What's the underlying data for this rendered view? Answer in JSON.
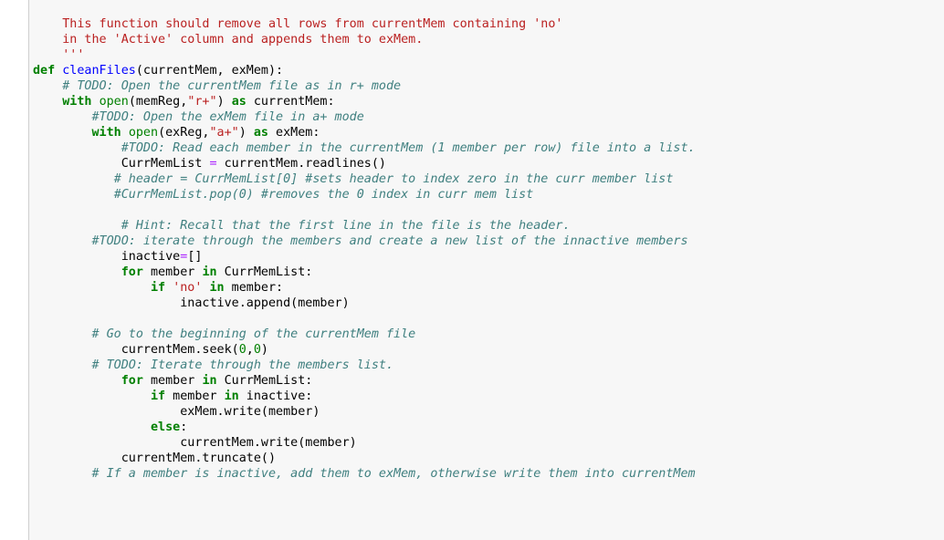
{
  "editor": {
    "lines": [
      [
        {
          "t": "    "
        },
        {
          "t": "This function should remove all rows from currentMem containing 'no'",
          "c": "doc"
        }
      ],
      [
        {
          "t": "    "
        },
        {
          "t": "in the 'Active' column and appends them to exMem.",
          "c": "doc"
        }
      ],
      [
        {
          "t": "    "
        },
        {
          "t": "'''",
          "c": "doc"
        }
      ],
      [
        {
          "t": "def",
          "c": "kw"
        },
        {
          "t": " "
        },
        {
          "t": "cleanFiles",
          "c": "fn"
        },
        {
          "t": "(currentMem, exMem):"
        }
      ],
      [
        {
          "t": "    "
        },
        {
          "t": "# TODO: Open the currentMem file as in r+ mode",
          "c": "cm"
        }
      ],
      [
        {
          "t": "    "
        },
        {
          "t": "with",
          "c": "kw"
        },
        {
          "t": " "
        },
        {
          "t": "open",
          "c": "nb"
        },
        {
          "t": "(memReg,"
        },
        {
          "t": "\"r+\"",
          "c": "st"
        },
        {
          "t": ") "
        },
        {
          "t": "as",
          "c": "kw"
        },
        {
          "t": " currentMem:"
        }
      ],
      [
        {
          "t": "        "
        },
        {
          "t": "#TODO: Open the exMem file in a+ mode",
          "c": "cm"
        }
      ],
      [
        {
          "t": "        "
        },
        {
          "t": "with",
          "c": "kw"
        },
        {
          "t": " "
        },
        {
          "t": "open",
          "c": "nb"
        },
        {
          "t": "(exReg,"
        },
        {
          "t": "\"a+\"",
          "c": "st"
        },
        {
          "t": ") "
        },
        {
          "t": "as",
          "c": "kw"
        },
        {
          "t": " exMem:"
        }
      ],
      [
        {
          "t": "            "
        },
        {
          "t": "#TODO: Read each member in the currentMem (1 member per row) file into a list.",
          "c": "cm"
        }
      ],
      [
        {
          "t": "            CurrMemList "
        },
        {
          "t": "=",
          "c": "op"
        },
        {
          "t": " currentMem.readlines()"
        }
      ],
      [
        {
          "t": "           "
        },
        {
          "t": "# header = CurrMemList[0] #sets header to index zero in the curr member list",
          "c": "cm"
        }
      ],
      [
        {
          "t": "           "
        },
        {
          "t": "#CurrMemList.pop(0) #removes the 0 index in curr mem list",
          "c": "cm"
        }
      ],
      [
        {
          "t": ""
        }
      ],
      [
        {
          "t": "            "
        },
        {
          "t": "# Hint: Recall that the first line in the file is the header.",
          "c": "cm"
        }
      ],
      [
        {
          "t": "        "
        },
        {
          "t": "#TODO: iterate through the members and create a new list of the innactive members",
          "c": "cm"
        }
      ],
      [
        {
          "t": "            inactive"
        },
        {
          "t": "=",
          "c": "op"
        },
        {
          "t": "[]"
        }
      ],
      [
        {
          "t": "            "
        },
        {
          "t": "for",
          "c": "kw"
        },
        {
          "t": " member "
        },
        {
          "t": "in",
          "c": "kw"
        },
        {
          "t": " CurrMemList:"
        }
      ],
      [
        {
          "t": "                "
        },
        {
          "t": "if",
          "c": "kw"
        },
        {
          "t": " "
        },
        {
          "t": "'no'",
          "c": "st"
        },
        {
          "t": " "
        },
        {
          "t": "in",
          "c": "kw"
        },
        {
          "t": " member:"
        }
      ],
      [
        {
          "t": "                    inactive.append(member)"
        }
      ],
      [
        {
          "t": ""
        }
      ],
      [
        {
          "t": "        "
        },
        {
          "t": "# Go to the beginning of the currentMem file",
          "c": "cm"
        }
      ],
      [
        {
          "t": "            currentMem.seek("
        },
        {
          "t": "0",
          "c": "num"
        },
        {
          "t": ","
        },
        {
          "t": "0",
          "c": "num"
        },
        {
          "t": ")"
        }
      ],
      [
        {
          "t": "        "
        },
        {
          "t": "# TODO: Iterate through the members list.",
          "c": "cm"
        }
      ],
      [
        {
          "t": "            "
        },
        {
          "t": "for",
          "c": "kw"
        },
        {
          "t": " member "
        },
        {
          "t": "in",
          "c": "kw"
        },
        {
          "t": " CurrMemList:"
        }
      ],
      [
        {
          "t": "                "
        },
        {
          "t": "if",
          "c": "kw"
        },
        {
          "t": " member "
        },
        {
          "t": "in",
          "c": "kw"
        },
        {
          "t": " inactive:"
        }
      ],
      [
        {
          "t": "                    exMem.write(member)"
        }
      ],
      [
        {
          "t": "                "
        },
        {
          "t": "else",
          "c": "kw"
        },
        {
          "t": ":"
        }
      ],
      [
        {
          "t": "                    currentMem.write(member)"
        }
      ],
      [
        {
          "t": "            currentMem.truncate()"
        }
      ],
      [
        {
          "t": "        "
        },
        {
          "t": "# If a member is inactive, add them to exMem, otherwise write them into currentMem",
          "c": "cm"
        }
      ]
    ]
  }
}
